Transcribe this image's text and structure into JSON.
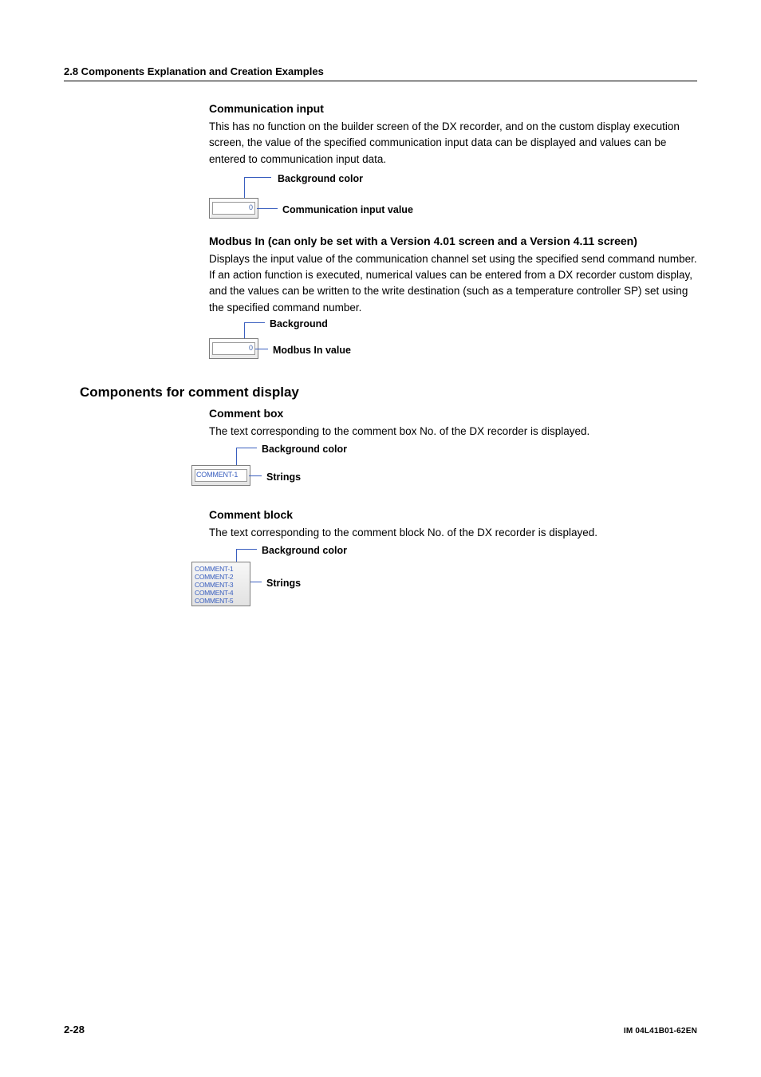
{
  "header": {
    "section": "2.8  Components Explanation and Creation Examples"
  },
  "comm_input": {
    "title": "Communication input",
    "body": "This has no function on the builder screen of the DX recorder, and on the custom display execution screen, the value of the specified communication input data can be displayed and values can be entered to communication input data.",
    "diag": {
      "box_value": "0",
      "lab_bg": "Background color",
      "lab_val": "Communication input value"
    }
  },
  "modbus": {
    "title": "Modbus In (can only be set with a Version 4.01 screen and a Version 4.11 screen)",
    "body": "Displays the input value of the communication channel set using the specified send command number. If an action function is executed, numerical values can be entered from a DX recorder custom display, and the values can be written to the write destination (such as a temperature controller SP) set using the specified command number.",
    "diag": {
      "box_value": "0",
      "lab_bg": "Background",
      "lab_val": "Modbus In value"
    }
  },
  "section_h2": "Components for comment display",
  "comment_box": {
    "title": "Comment box",
    "body": "The text corresponding to the comment box No. of the DX recorder is displayed.",
    "diag": {
      "box_text": "COMMENT-1",
      "lab_bg": "Background color",
      "lab_str": "Strings"
    }
  },
  "comment_block": {
    "title": "Comment block",
    "body": "The text corresponding to the comment block No. of the DX recorder is displayed.",
    "diag": {
      "lines": [
        "COMMENT-1",
        "COMMENT-2",
        "COMMENT-3",
        "COMMENT-4",
        "COMMENT-5"
      ],
      "lab_bg": "Background color",
      "lab_str": "Strings"
    }
  },
  "footer": {
    "page": "2-28",
    "docid": "IM 04L41B01-62EN"
  }
}
